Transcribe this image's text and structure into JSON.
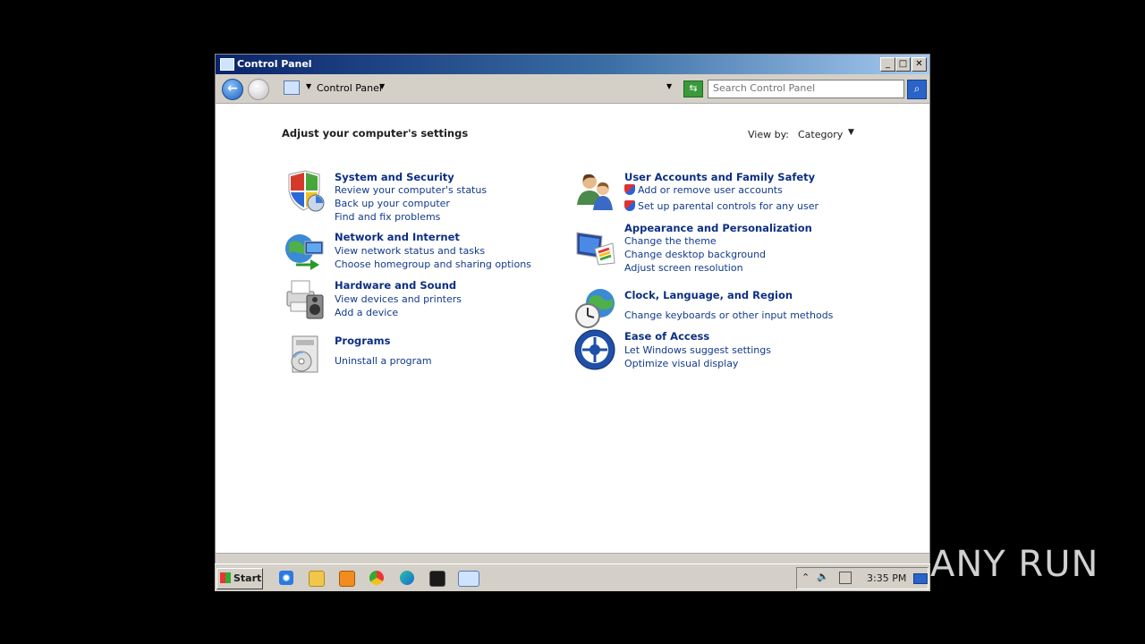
{
  "window": {
    "title": "Control Panel",
    "controls": {
      "minimize": "_",
      "maximize": "□",
      "close": "✕"
    }
  },
  "toolbar": {
    "back_icon": "back-arrow-icon",
    "forward_icon": "forward-arrow-icon",
    "breadcrumb": "Control Panel",
    "search_placeholder": "Search Control Panel"
  },
  "main": {
    "heading": "Adjust your computer's settings",
    "view_by_label": "View by:",
    "view_by_value": "Category",
    "categories": [
      {
        "title": "System and Security",
        "icon": "shield-icon",
        "links": [
          "Review your computer's status",
          "Back up your computer",
          "Find and fix problems"
        ]
      },
      {
        "title": "Network and Internet",
        "icon": "globe-network-icon",
        "links": [
          "View network status and tasks",
          "Choose homegroup and sharing options"
        ]
      },
      {
        "title": "Hardware and Sound",
        "icon": "printer-speaker-icon",
        "links": [
          "View devices and printers",
          "Add a device"
        ]
      },
      {
        "title": "Programs",
        "icon": "programs-icon",
        "links": [
          "Uninstall a program"
        ]
      },
      {
        "title": "User Accounts and Family Safety",
        "icon": "users-icon",
        "links": [
          "Add or remove user accounts",
          "Set up parental controls for any user"
        ]
      },
      {
        "title": "Appearance and Personalization",
        "icon": "monitor-palette-icon",
        "links": [
          "Change the theme",
          "Change desktop background",
          "Adjust screen resolution"
        ]
      },
      {
        "title": "Clock, Language, and Region",
        "icon": "clock-globe-icon",
        "links": [
          "Change keyboards or other input methods"
        ]
      },
      {
        "title": "Ease of Access",
        "icon": "ease-of-access-icon",
        "links": [
          "Let Windows suggest settings",
          "Optimize visual display"
        ]
      }
    ]
  },
  "taskbar": {
    "start_label": "Start",
    "clock": "3:35 PM",
    "pinned": [
      "internet-explorer-icon",
      "folder-icon",
      "media-player-icon",
      "chrome-icon",
      "edge-icon",
      "terminal-icon",
      "control-panel-icon"
    ]
  },
  "watermark": "ANY RUN",
  "colors": {
    "link": "#123a8a",
    "title_link": "#0d2f82",
    "titlebar_start": "#0a246a",
    "titlebar_end": "#a6caf0"
  }
}
